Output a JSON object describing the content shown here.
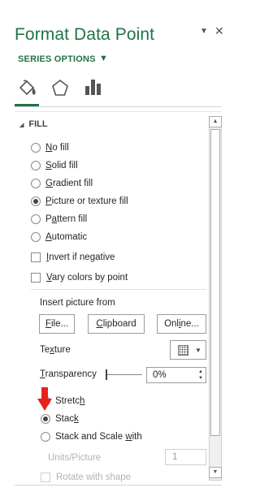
{
  "pane": {
    "title": "Format Data Point",
    "series_options": "SERIES OPTIONS",
    "icons": [
      "fill-line-icon",
      "effects-pentagon-icon",
      "series-options-bar-icon",
      "dropdown-caret-icon",
      "close-icon"
    ]
  },
  "fill": {
    "section_label": "FILL",
    "options": [
      {
        "label_pre": "",
        "label_u": "N",
        "label_post": "o fill",
        "selected": false
      },
      {
        "label_pre": "",
        "label_u": "S",
        "label_post": "olid fill",
        "selected": false
      },
      {
        "label_pre": "",
        "label_u": "G",
        "label_post": "radient fill",
        "selected": false
      },
      {
        "label_pre": "",
        "label_u": "P",
        "label_post": "icture or texture fill",
        "selected": true
      },
      {
        "label_pre": "P",
        "label_u": "a",
        "label_post": "ttern fill",
        "selected": false
      },
      {
        "label_pre": "",
        "label_u": "A",
        "label_post": "utomatic",
        "selected": false
      }
    ],
    "invert_if_negative": {
      "pre": "",
      "u": "I",
      "post": "nvert if negative",
      "checked": false
    },
    "vary_colors": {
      "pre": "",
      "u": "V",
      "post": "ary colors by point",
      "checked": false
    },
    "insert_picture_from": "Insert picture from",
    "buttons": {
      "file": {
        "pre": "",
        "u": "F",
        "post": "ile..."
      },
      "clipboard": {
        "pre": "",
        "u": "C",
        "post": "lipboard"
      },
      "online": {
        "pre": "Onl",
        "u": "i",
        "post": "ne..."
      }
    },
    "texture": {
      "pre": "Te",
      "u": "x",
      "post": "ture"
    },
    "transparency": {
      "pre": "",
      "u": "T",
      "post": "ransparency",
      "value": "0%",
      "level": 0
    },
    "placement": [
      {
        "pre": "Stretc",
        "u": "h",
        "post": "",
        "selected": false
      },
      {
        "pre": "Stac",
        "u": "k",
        "post": "",
        "selected": true
      },
      {
        "pre": "Stack and Scale ",
        "u": "w",
        "post": "ith",
        "selected": false
      }
    ],
    "units_per_picture": {
      "label": "Units/Picture",
      "value": "1"
    },
    "rotate_with_shape": "Rotate with shape"
  },
  "colors": {
    "accent": "#217346",
    "annotation_arrow": "#e8201a"
  }
}
